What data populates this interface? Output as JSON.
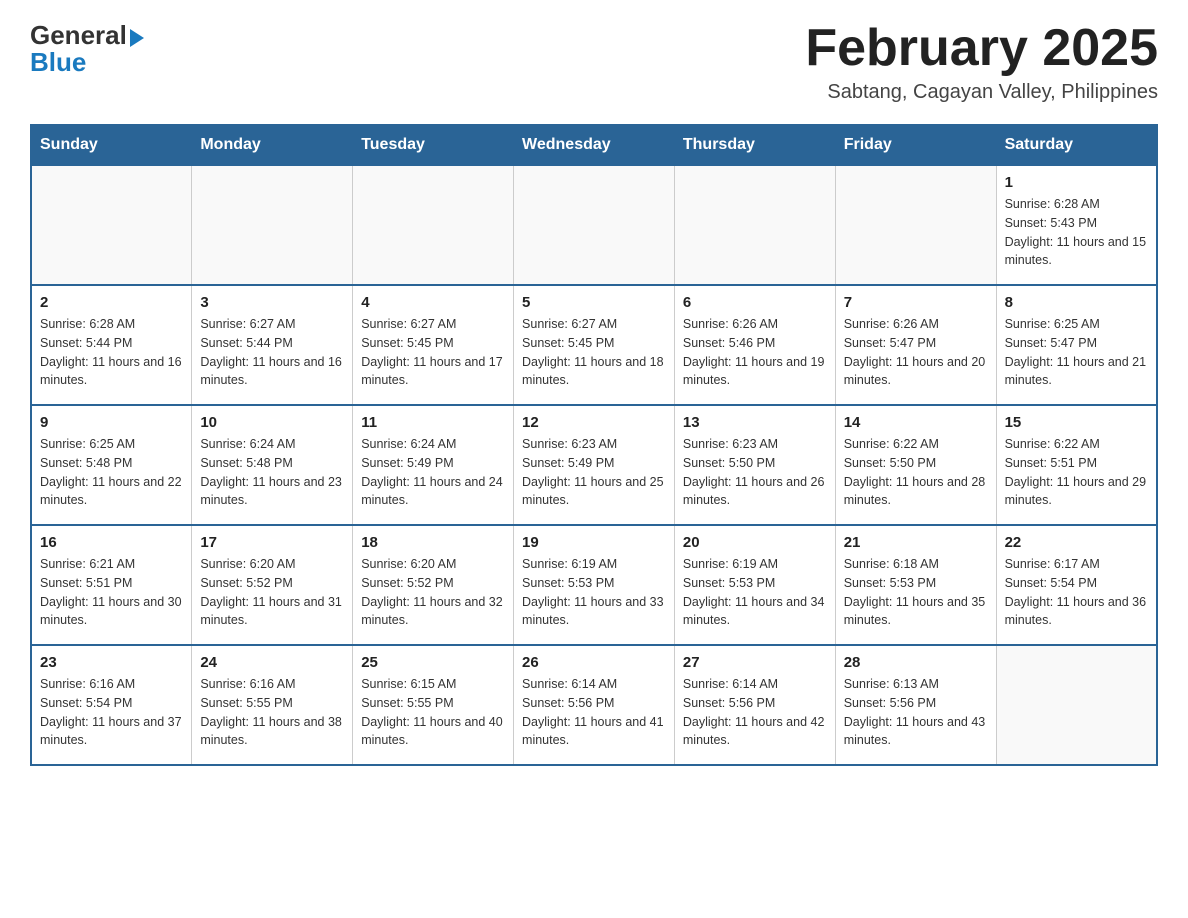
{
  "header": {
    "logo_general": "General",
    "logo_blue": "Blue",
    "month_title": "February 2025",
    "location": "Sabtang, Cagayan Valley, Philippines"
  },
  "weekdays": [
    "Sunday",
    "Monday",
    "Tuesday",
    "Wednesday",
    "Thursday",
    "Friday",
    "Saturday"
  ],
  "weeks": [
    [
      {
        "day": "",
        "sunrise": "",
        "sunset": "",
        "daylight": ""
      },
      {
        "day": "",
        "sunrise": "",
        "sunset": "",
        "daylight": ""
      },
      {
        "day": "",
        "sunrise": "",
        "sunset": "",
        "daylight": ""
      },
      {
        "day": "",
        "sunrise": "",
        "sunset": "",
        "daylight": ""
      },
      {
        "day": "",
        "sunrise": "",
        "sunset": "",
        "daylight": ""
      },
      {
        "day": "",
        "sunrise": "",
        "sunset": "",
        "daylight": ""
      },
      {
        "day": "1",
        "sunrise": "Sunrise: 6:28 AM",
        "sunset": "Sunset: 5:43 PM",
        "daylight": "Daylight: 11 hours and 15 minutes."
      }
    ],
    [
      {
        "day": "2",
        "sunrise": "Sunrise: 6:28 AM",
        "sunset": "Sunset: 5:44 PM",
        "daylight": "Daylight: 11 hours and 16 minutes."
      },
      {
        "day": "3",
        "sunrise": "Sunrise: 6:27 AM",
        "sunset": "Sunset: 5:44 PM",
        "daylight": "Daylight: 11 hours and 16 minutes."
      },
      {
        "day": "4",
        "sunrise": "Sunrise: 6:27 AM",
        "sunset": "Sunset: 5:45 PM",
        "daylight": "Daylight: 11 hours and 17 minutes."
      },
      {
        "day": "5",
        "sunrise": "Sunrise: 6:27 AM",
        "sunset": "Sunset: 5:45 PM",
        "daylight": "Daylight: 11 hours and 18 minutes."
      },
      {
        "day": "6",
        "sunrise": "Sunrise: 6:26 AM",
        "sunset": "Sunset: 5:46 PM",
        "daylight": "Daylight: 11 hours and 19 minutes."
      },
      {
        "day": "7",
        "sunrise": "Sunrise: 6:26 AM",
        "sunset": "Sunset: 5:47 PM",
        "daylight": "Daylight: 11 hours and 20 minutes."
      },
      {
        "day": "8",
        "sunrise": "Sunrise: 6:25 AM",
        "sunset": "Sunset: 5:47 PM",
        "daylight": "Daylight: 11 hours and 21 minutes."
      }
    ],
    [
      {
        "day": "9",
        "sunrise": "Sunrise: 6:25 AM",
        "sunset": "Sunset: 5:48 PM",
        "daylight": "Daylight: 11 hours and 22 minutes."
      },
      {
        "day": "10",
        "sunrise": "Sunrise: 6:24 AM",
        "sunset": "Sunset: 5:48 PM",
        "daylight": "Daylight: 11 hours and 23 minutes."
      },
      {
        "day": "11",
        "sunrise": "Sunrise: 6:24 AM",
        "sunset": "Sunset: 5:49 PM",
        "daylight": "Daylight: 11 hours and 24 minutes."
      },
      {
        "day": "12",
        "sunrise": "Sunrise: 6:23 AM",
        "sunset": "Sunset: 5:49 PM",
        "daylight": "Daylight: 11 hours and 25 minutes."
      },
      {
        "day": "13",
        "sunrise": "Sunrise: 6:23 AM",
        "sunset": "Sunset: 5:50 PM",
        "daylight": "Daylight: 11 hours and 26 minutes."
      },
      {
        "day": "14",
        "sunrise": "Sunrise: 6:22 AM",
        "sunset": "Sunset: 5:50 PM",
        "daylight": "Daylight: 11 hours and 28 minutes."
      },
      {
        "day": "15",
        "sunrise": "Sunrise: 6:22 AM",
        "sunset": "Sunset: 5:51 PM",
        "daylight": "Daylight: 11 hours and 29 minutes."
      }
    ],
    [
      {
        "day": "16",
        "sunrise": "Sunrise: 6:21 AM",
        "sunset": "Sunset: 5:51 PM",
        "daylight": "Daylight: 11 hours and 30 minutes."
      },
      {
        "day": "17",
        "sunrise": "Sunrise: 6:20 AM",
        "sunset": "Sunset: 5:52 PM",
        "daylight": "Daylight: 11 hours and 31 minutes."
      },
      {
        "day": "18",
        "sunrise": "Sunrise: 6:20 AM",
        "sunset": "Sunset: 5:52 PM",
        "daylight": "Daylight: 11 hours and 32 minutes."
      },
      {
        "day": "19",
        "sunrise": "Sunrise: 6:19 AM",
        "sunset": "Sunset: 5:53 PM",
        "daylight": "Daylight: 11 hours and 33 minutes."
      },
      {
        "day": "20",
        "sunrise": "Sunrise: 6:19 AM",
        "sunset": "Sunset: 5:53 PM",
        "daylight": "Daylight: 11 hours and 34 minutes."
      },
      {
        "day": "21",
        "sunrise": "Sunrise: 6:18 AM",
        "sunset": "Sunset: 5:53 PM",
        "daylight": "Daylight: 11 hours and 35 minutes."
      },
      {
        "day": "22",
        "sunrise": "Sunrise: 6:17 AM",
        "sunset": "Sunset: 5:54 PM",
        "daylight": "Daylight: 11 hours and 36 minutes."
      }
    ],
    [
      {
        "day": "23",
        "sunrise": "Sunrise: 6:16 AM",
        "sunset": "Sunset: 5:54 PM",
        "daylight": "Daylight: 11 hours and 37 minutes."
      },
      {
        "day": "24",
        "sunrise": "Sunrise: 6:16 AM",
        "sunset": "Sunset: 5:55 PM",
        "daylight": "Daylight: 11 hours and 38 minutes."
      },
      {
        "day": "25",
        "sunrise": "Sunrise: 6:15 AM",
        "sunset": "Sunset: 5:55 PM",
        "daylight": "Daylight: 11 hours and 40 minutes."
      },
      {
        "day": "26",
        "sunrise": "Sunrise: 6:14 AM",
        "sunset": "Sunset: 5:56 PM",
        "daylight": "Daylight: 11 hours and 41 minutes."
      },
      {
        "day": "27",
        "sunrise": "Sunrise: 6:14 AM",
        "sunset": "Sunset: 5:56 PM",
        "daylight": "Daylight: 11 hours and 42 minutes."
      },
      {
        "day": "28",
        "sunrise": "Sunrise: 6:13 AM",
        "sunset": "Sunset: 5:56 PM",
        "daylight": "Daylight: 11 hours and 43 minutes."
      },
      {
        "day": "",
        "sunrise": "",
        "sunset": "",
        "daylight": ""
      }
    ]
  ]
}
